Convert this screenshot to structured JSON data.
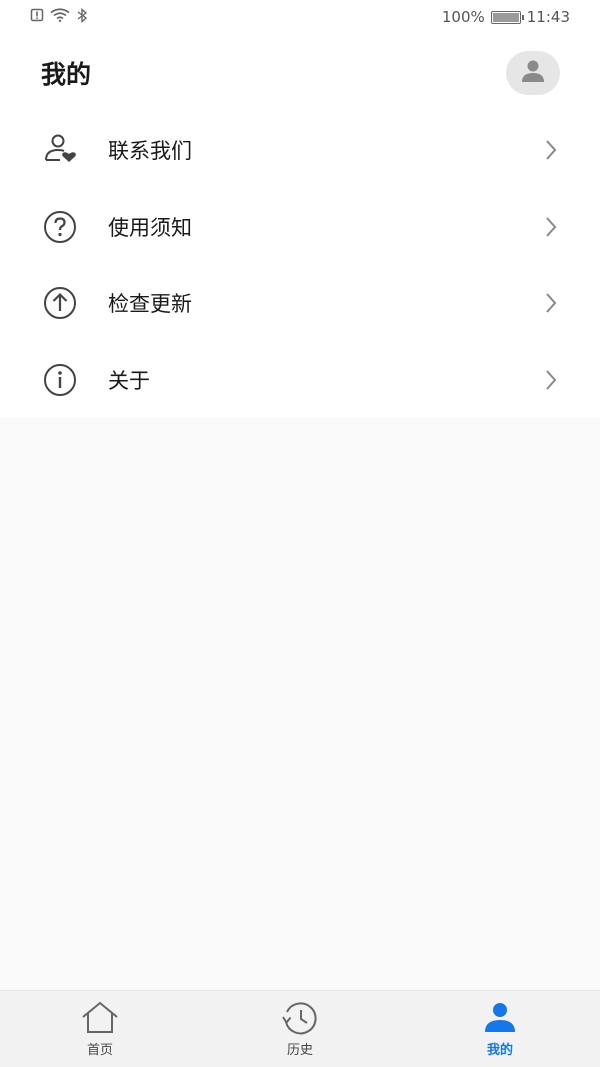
{
  "status_bar": {
    "battery": "100%",
    "time": "11:43",
    "icons": [
      "sim-alert-icon",
      "wifi-icon",
      "bluetooth-icon",
      "battery-icon"
    ]
  },
  "header": {
    "title": "我的",
    "avatar_icon": "user-icon"
  },
  "menu": {
    "items": [
      {
        "label": "联系我们",
        "icon": "contact-heart-icon"
      },
      {
        "label": "使用须知",
        "icon": "question-circle-icon"
      },
      {
        "label": "检查更新",
        "icon": "upload-circle-icon"
      },
      {
        "label": "关于",
        "icon": "info-circle-icon"
      }
    ]
  },
  "tabbar": {
    "tabs": [
      {
        "label": "首页",
        "icon": "home-icon",
        "active": false
      },
      {
        "label": "历史",
        "icon": "history-icon",
        "active": false
      },
      {
        "label": "我的",
        "icon": "user-icon",
        "active": true
      }
    ],
    "active_color": "#1677e6"
  }
}
